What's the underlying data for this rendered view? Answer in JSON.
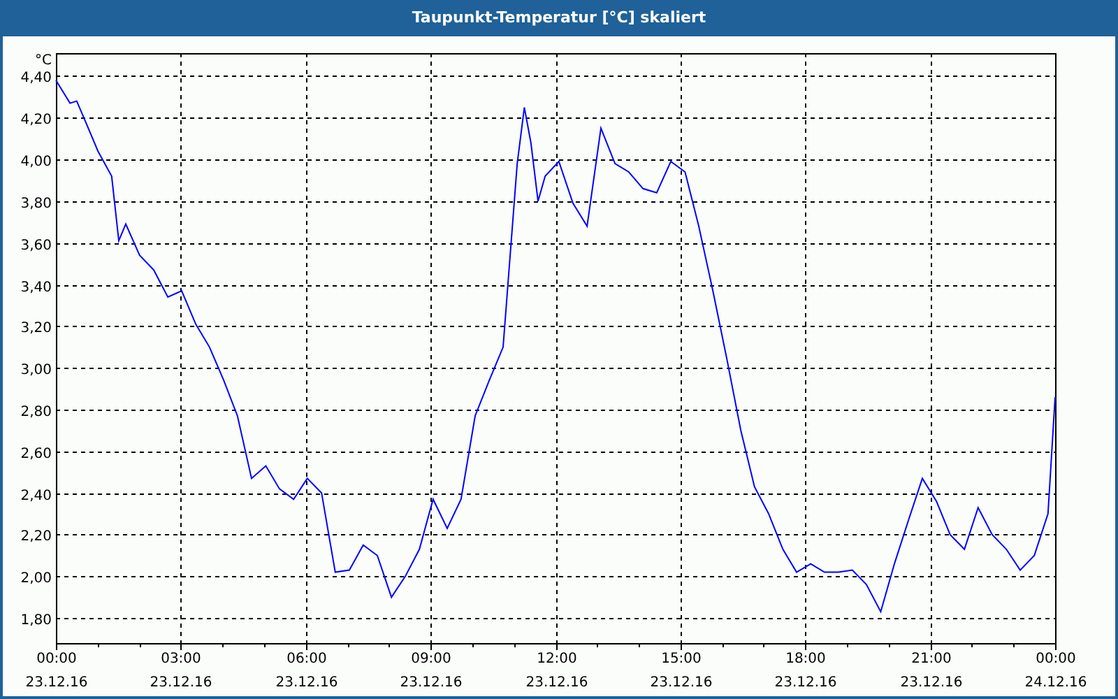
{
  "window": {
    "title": "Taupunkt-Temperatur [°C] skaliert"
  },
  "chart": {
    "x_axis_dates": [
      "23.12.16",
      "23.12.16",
      "23.12.16",
      "23.12.16",
      "23.12.16",
      "23.12.16",
      "23.12.16",
      "23.12.16",
      "24.12.16"
    ],
    "chart_data": {
      "type": "line",
      "grid": true,
      "ylabel": "°C",
      "xlim": [
        0,
        24
      ],
      "ylim": [
        1.68,
        4.51
      ],
      "x": [
        0,
        0.34,
        0.5,
        0.67,
        1.01,
        1.34,
        1.51,
        1.68,
        2.01,
        2.35,
        2.69,
        3.02,
        3.36,
        3.69,
        4.03,
        4.36,
        4.7,
        5.04,
        5.37,
        5.71,
        6.04,
        6.38,
        6.71,
        7.05,
        7.38,
        7.72,
        8.06,
        8.39,
        8.73,
        9.06,
        9.4,
        9.73,
        10.07,
        10.41,
        10.74,
        11.08,
        11.25,
        11.41,
        11.58,
        11.75,
        12.08,
        12.42,
        12.76,
        13.09,
        13.43,
        13.76,
        14.1,
        14.43,
        14.77,
        15.11,
        15.44,
        15.78,
        16.11,
        16.45,
        16.78,
        17.12,
        17.46,
        17.79,
        18.13,
        18.46,
        18.8,
        19.13,
        19.47,
        19.81,
        20.14,
        20.48,
        20.81,
        21.15,
        21.48,
        21.82,
        22.15,
        22.49,
        22.83,
        23.16,
        23.5,
        23.83,
        24
      ],
      "series": [
        {
          "color": "#0000ff",
          "values": [
            4.38,
            4.27,
            4.28,
            4.2,
            4.04,
            3.92,
            3.61,
            3.69,
            3.54,
            3.47,
            3.34,
            3.37,
            3.21,
            3.1,
            2.94,
            2.77,
            2.47,
            2.53,
            2.42,
            2.37,
            2.47,
            2.4,
            2.02,
            2.03,
            2.15,
            2.1,
            1.9,
            2.0,
            2.13,
            2.37,
            2.23,
            2.37,
            2.77,
            2.94,
            3.1,
            3.98,
            4.25,
            4.08,
            3.8,
            3.92,
            3.99,
            3.79,
            3.68,
            4.15,
            3.98,
            3.94,
            3.86,
            3.84,
            3.99,
            3.94,
            3.68,
            3.37,
            3.05,
            2.7,
            2.43,
            2.3,
            2.13,
            2.02,
            2.06,
            2.02,
            2.02,
            2.03,
            1.96,
            1.83,
            2.06,
            2.27,
            2.47,
            2.36,
            2.2,
            2.13,
            2.33,
            2.2,
            2.13,
            2.03,
            2.1,
            2.3,
            2.86
          ]
        }
      ],
      "xticks": [
        {
          "value": 0,
          "label": "00:00"
        },
        {
          "value": 3,
          "label": "03:00"
        },
        {
          "value": 6,
          "label": "06:00"
        },
        {
          "value": 9,
          "label": "09:00"
        },
        {
          "value": 12,
          "label": "12:00"
        },
        {
          "value": 15,
          "label": "15:00"
        },
        {
          "value": 18,
          "label": "18:00"
        },
        {
          "value": 21,
          "label": "21:00"
        },
        {
          "value": 24,
          "label": "00:00"
        }
      ],
      "yticks": [
        {
          "value": 1.8,
          "label": "1,80"
        },
        {
          "value": 2.0,
          "label": "2,00"
        },
        {
          "value": 2.2,
          "label": "2,20"
        },
        {
          "value": 2.4,
          "label": "2,40"
        },
        {
          "value": 2.6,
          "label": "2,60"
        },
        {
          "value": 2.8,
          "label": "2,80"
        },
        {
          "value": 3.0,
          "label": "3,00"
        },
        {
          "value": 3.2,
          "label": "3,20"
        },
        {
          "value": 3.4,
          "label": "3,40"
        },
        {
          "value": 3.6,
          "label": "3,60"
        },
        {
          "value": 3.8,
          "label": "3,80"
        },
        {
          "value": 4.0,
          "label": "4,00"
        },
        {
          "value": 4.2,
          "label": "4,20"
        },
        {
          "value": 4.4,
          "label": "4,40"
        }
      ]
    }
  }
}
